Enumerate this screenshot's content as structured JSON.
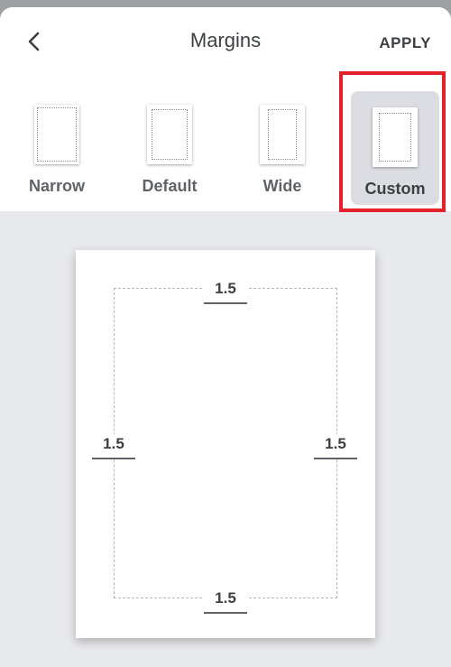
{
  "header": {
    "title": "Margins",
    "apply_label": "APPLY"
  },
  "presets": [
    {
      "label": "Narrow",
      "selected": false
    },
    {
      "label": "Default",
      "selected": false
    },
    {
      "label": "Wide",
      "selected": false
    },
    {
      "label": "Custom",
      "selected": true
    }
  ],
  "margins": {
    "top": "1.5",
    "left": "1.5",
    "right": "1.5",
    "bottom": "1.5"
  },
  "colors": {
    "highlight": "#e5202a",
    "selected_bg": "#dcdde2",
    "canvas_bg": "#e8e9ec"
  },
  "icons": {
    "back": "chevron-left-icon"
  }
}
